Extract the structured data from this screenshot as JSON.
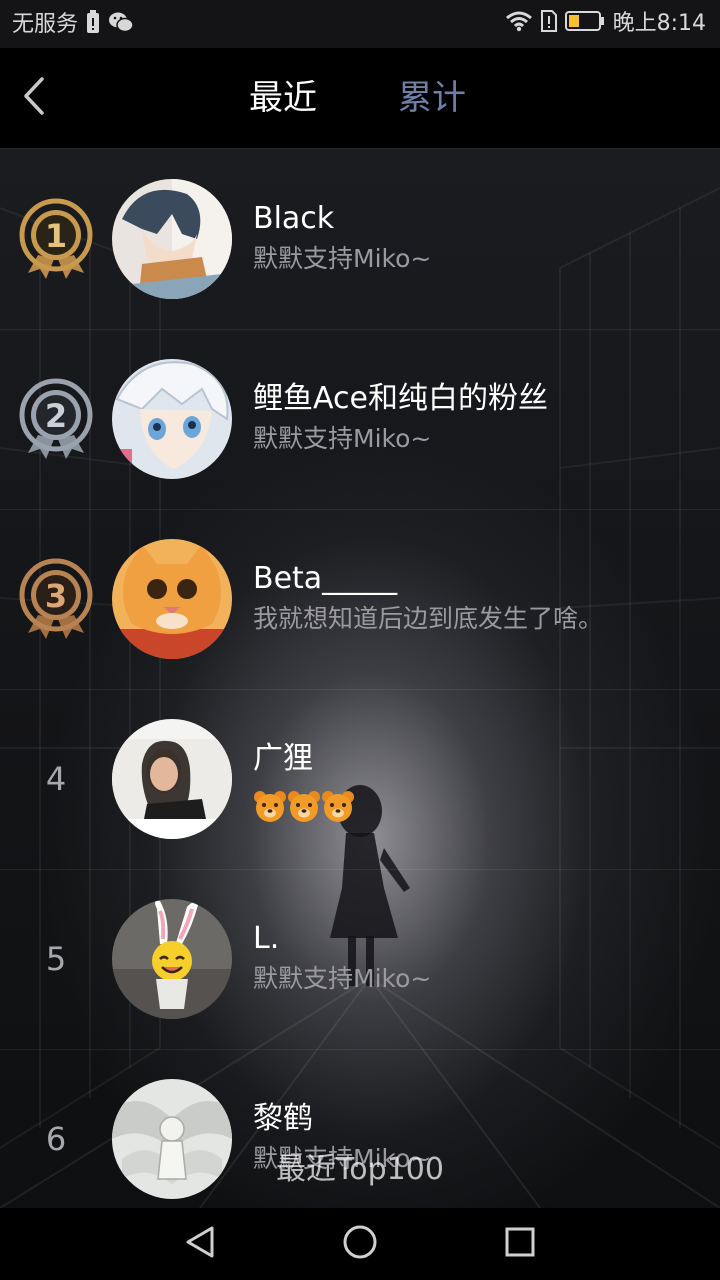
{
  "status_bar": {
    "carrier": "无服务",
    "time": "晚上8:14",
    "icons": [
      "battery-saver-icon",
      "wechat-icon",
      "wifi-icon",
      "sim-alert-icon",
      "battery-low-icon"
    ]
  },
  "header": {
    "back_icon": "chevron-left-icon",
    "tabs": [
      {
        "label": "最近",
        "active": true
      },
      {
        "label": "累计",
        "active": false
      }
    ]
  },
  "ranking": [
    {
      "rank": "1",
      "badge": "gold-medal",
      "name": "Black",
      "comment": "默默支持Miko~"
    },
    {
      "rank": "2",
      "badge": "silver-medal",
      "name": "鲤鱼Ace和纯白的粉丝",
      "comment": "默默支持Miko~"
    },
    {
      "rank": "3",
      "badge": "bronze-medal",
      "name": "Beta_____",
      "comment": "我就想知道后边到底发生了啥。"
    },
    {
      "rank": "4",
      "badge": "",
      "name": "广狸",
      "comment": "",
      "emojis": [
        "bear-emoji",
        "bear-emoji",
        "bear-emoji"
      ]
    },
    {
      "rank": "5",
      "badge": "",
      "name": "L.",
      "comment": "默默支持Miko~"
    },
    {
      "rank": "6",
      "badge": "",
      "name": "黎鹤",
      "comment": "默默支持Miko~"
    }
  ],
  "footer": {
    "caption": "最近Top100"
  },
  "nav_bar": {
    "icons": [
      "back-triangle-icon",
      "home-circle-icon",
      "recents-square-icon"
    ]
  },
  "colors": {
    "active_tab": "#ffffff",
    "inactive_tab": "#6f7fa6",
    "gold": "#c89a4e",
    "silver": "#9aa3ad",
    "bronze": "#b88352"
  }
}
